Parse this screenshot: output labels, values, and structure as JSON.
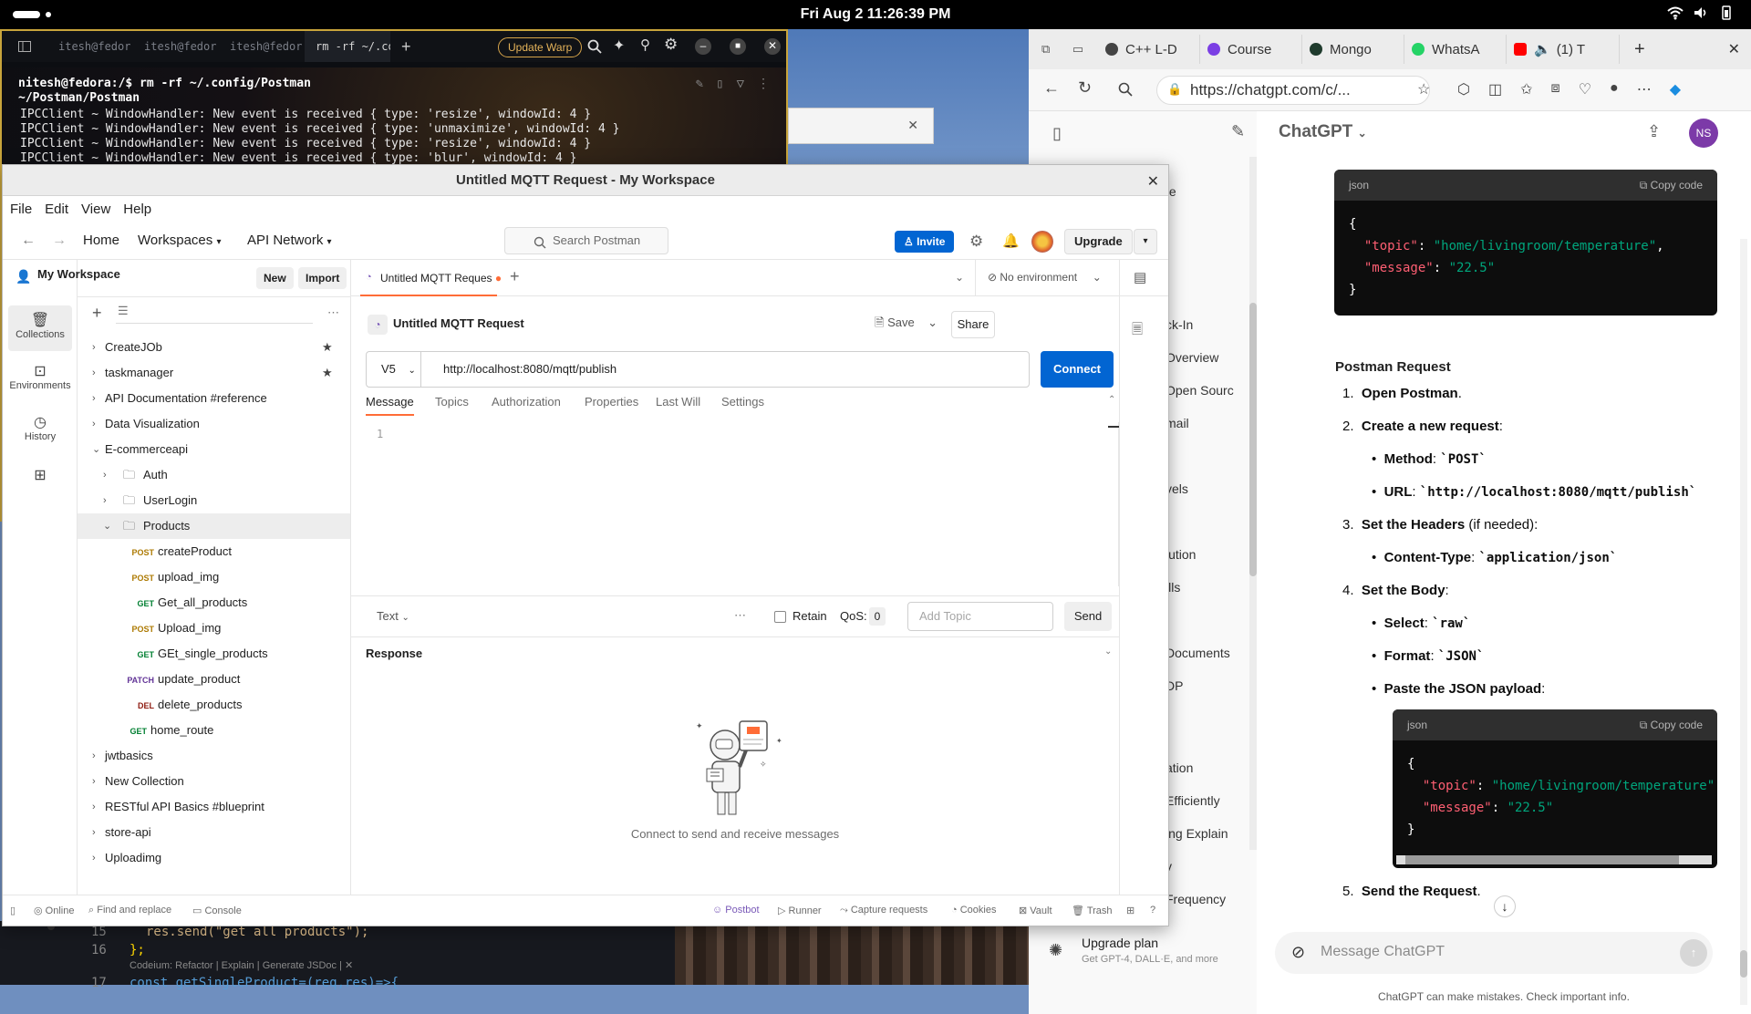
{
  "system": {
    "clock": "Fri Aug 2  11:26:39 PM"
  },
  "warp": {
    "tabs": [
      "itesh@fedor",
      "itesh@fedor",
      "itesh@fedor",
      "rm -rf ~/.confi"
    ],
    "update_label": "Update Warp",
    "prompt_line1": "nitesh@fedora:/$ rm -rf ~/.config/Postman",
    "prompt_line2": "~/Postman/Postman",
    "log": [
      "IPCClient ~ WindowHandler: New event is received { type: 'resize', windowId: 4 }",
      "IPCClient ~ WindowHandler: New event is received { type: 'unmaximize', windowId: 4 }",
      "IPCClient ~ WindowHandler: New event is received { type: 'resize', windowId: 4 }",
      "IPCClient ~ WindowHandler: New event is received { type: 'blur', windowId: 4 }"
    ]
  },
  "code_editor": {
    "lines": [
      {
        "num": "15",
        "code": "res.send(\"get all products\");"
      },
      {
        "num": "16",
        "code": "};"
      },
      {
        "num": "17",
        "code": "const getSingleProduct=(req,res)=>{"
      }
    ],
    "codeium_hint": "Codeium: Refactor | Explain | Generate JSDoc | ✕"
  },
  "edge": {
    "tabs": [
      {
        "label": "C++ L-D",
        "color": "#444444"
      },
      {
        "label": "Course",
        "color": "#7b3fe4"
      },
      {
        "label": "Mongo",
        "color": "#1f3b2d"
      },
      {
        "label": "WhatsA",
        "color": "#25d366"
      },
      {
        "label": "(1) T",
        "color": "#ff0000"
      }
    ],
    "url": "https://chatgpt.com/c/...",
    "sidebar_fragments": [
      "te",
      "ck-In",
      "Overview",
      "Open Sourc",
      "mail",
      "vels",
      "lution",
      "ills",
      "Documents",
      "DP",
      "ation",
      "Efficiently",
      "ing Explain",
      "v",
      "Frequency"
    ],
    "upgrade_title": "Upgrade plan",
    "upgrade_sub": "Get GPT-4, DALL·E, and more"
  },
  "chatgpt": {
    "title": "ChatGPT",
    "avatar": "NS",
    "copy_code": "Copy code",
    "code_lang": "json",
    "code1": {
      "k1": "\"topic\"",
      "v1": "\"home/livingroom/temperature\"",
      "k2": "\"message\"",
      "v2": "\"22.5\""
    },
    "section": "Postman Request",
    "steps": {
      "s1": "Open Postman",
      "s2": "Create a new request",
      "method_label": "Method",
      "method_value": "`POST`",
      "url_label": "URL",
      "url_value": "`http://localhost:8080/mqtt/publish`",
      "s3": "Set the Headers",
      "s3_note": "(if needed):",
      "ct_label": "Content-Type",
      "ct_value": "`application/json`",
      "s4": "Set the Body",
      "select_label": "Select",
      "select_value": "`raw`",
      "format_label": "Format",
      "format_value": "`JSON`",
      "paste_label": "Paste the JSON payload",
      "s5": "Send the Request"
    },
    "composer_placeholder": "Message ChatGPT",
    "disclaimer": "ChatGPT can make mistakes. Check important info."
  },
  "postman": {
    "window_title": "Untitled MQTT Request - My Workspace",
    "menu": [
      "File",
      "Edit",
      "View",
      "Help"
    ],
    "nav": {
      "home": "Home",
      "workspaces": "Workspaces",
      "api_network": "API Network"
    },
    "search_placeholder": "Search Postman",
    "invite": "Invite",
    "upgrade": "Upgrade",
    "workspace": "My Workspace",
    "new": "New",
    "import": "Import",
    "rail": [
      "Collections",
      "Environments",
      "History"
    ],
    "tree": [
      {
        "label": "CreateJOb",
        "method": "",
        "indent": 0,
        "type": "collection",
        "star": true
      },
      {
        "label": "taskmanager",
        "method": "",
        "indent": 0,
        "type": "collection",
        "star": true
      },
      {
        "label": "API Documentation #reference",
        "method": "",
        "indent": 0,
        "type": "collection"
      },
      {
        "label": "Data Visualization",
        "method": "",
        "indent": 0,
        "type": "collection"
      },
      {
        "label": "E-commerceapi",
        "method": "",
        "indent": 0,
        "type": "collection",
        "open": true
      },
      {
        "label": "Auth",
        "method": "",
        "indent": 1,
        "type": "folder"
      },
      {
        "label": "UserLogin",
        "method": "",
        "indent": 1,
        "type": "folder"
      },
      {
        "label": "Products",
        "method": "",
        "indent": 1,
        "type": "folder",
        "open": true,
        "selected": true
      },
      {
        "label": "createProduct",
        "method": "POST",
        "indent": 2,
        "type": "request"
      },
      {
        "label": "upload_img",
        "method": "POST",
        "indent": 2,
        "type": "request"
      },
      {
        "label": "Get_all_products",
        "method": "GET",
        "indent": 2,
        "type": "request"
      },
      {
        "label": "Upload_img",
        "method": "POST",
        "indent": 2,
        "type": "request"
      },
      {
        "label": "GEt_single_products",
        "method": "GET",
        "indent": 2,
        "type": "request"
      },
      {
        "label": "update_product",
        "method": "PATCH",
        "indent": 2,
        "type": "request"
      },
      {
        "label": "delete_products",
        "method": "DEL",
        "indent": 2,
        "type": "request"
      },
      {
        "label": "home_route",
        "method": "GET",
        "indent": 1,
        "type": "request"
      },
      {
        "label": "jwtbasics",
        "method": "",
        "indent": 0,
        "type": "collection"
      },
      {
        "label": "New Collection",
        "method": "",
        "indent": 0,
        "type": "collection"
      },
      {
        "label": "RESTful API Basics #blueprint",
        "method": "",
        "indent": 0,
        "type": "collection"
      },
      {
        "label": "store-api",
        "method": "",
        "indent": 0,
        "type": "collection"
      },
      {
        "label": "Uploadimg",
        "method": "",
        "indent": 0,
        "type": "collection"
      }
    ],
    "tab_label": "Untitled MQTT Reques",
    "environment": "No environment",
    "request_title": "Untitled MQTT Request",
    "save": "Save",
    "share": "Share",
    "version": "V5",
    "url": "http://localhost:8080/mqtt/publish",
    "connect": "Connect",
    "subtabs": [
      "Message",
      "Topics",
      "Authorization",
      "Properties",
      "Last Will",
      "Settings"
    ],
    "line_number": "1",
    "text_format": "Text",
    "retain": "Retain",
    "qos_label": "QoS:",
    "qos_value": "0",
    "topic_placeholder": "Add Topic",
    "send": "Send",
    "response": "Response",
    "response_empty": "Connect to send and receive messages",
    "status": {
      "online": "Online",
      "find": "Find and replace",
      "console": "Console",
      "postbot": "Postbot",
      "runner": "Runner",
      "capture": "Capture requests",
      "cookies": "Cookies",
      "vault": "Vault",
      "trash": "Trash"
    }
  },
  "colors": {
    "postman_orange": "#ff6c37",
    "postman_blue": "#0265d2",
    "warp_border": "#c8a43b"
  }
}
